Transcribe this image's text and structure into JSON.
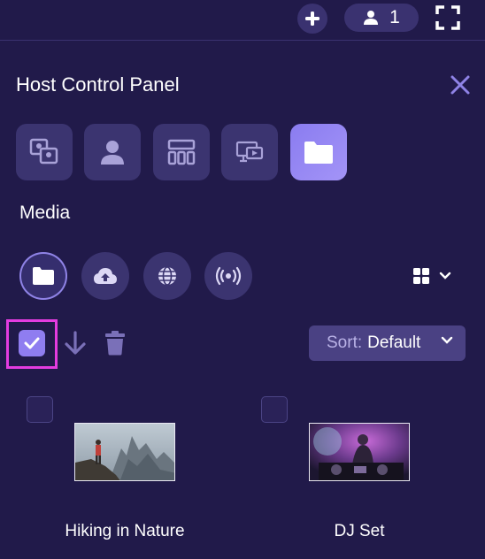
{
  "topbar": {
    "participant_count": "1"
  },
  "panel": {
    "title": "Host Control Panel"
  },
  "tools": [
    {
      "icon": "layout-swap-icon",
      "active": false
    },
    {
      "icon": "user-icon",
      "active": false
    },
    {
      "icon": "layout-grid-icon",
      "active": false
    },
    {
      "icon": "screen-share-icon",
      "active": false
    },
    {
      "icon": "folder-icon",
      "active": true
    }
  ],
  "media": {
    "section_title": "Media",
    "sources": [
      {
        "icon": "folder-icon",
        "active": true
      },
      {
        "icon": "cloud-upload-icon",
        "active": false
      },
      {
        "icon": "globe-icon",
        "active": false
      },
      {
        "icon": "broadcast-icon",
        "active": false
      }
    ],
    "sort_prefix": "Sort:",
    "sort_value": "Default",
    "items": [
      {
        "label": "Hiking in Nature",
        "checked": false
      },
      {
        "label": "DJ Set",
        "checked": false
      }
    ]
  },
  "colors": {
    "background": "#211a4a",
    "button": "#3b3470",
    "accent": "#8f7df0",
    "highlight": "#e43ce0"
  }
}
